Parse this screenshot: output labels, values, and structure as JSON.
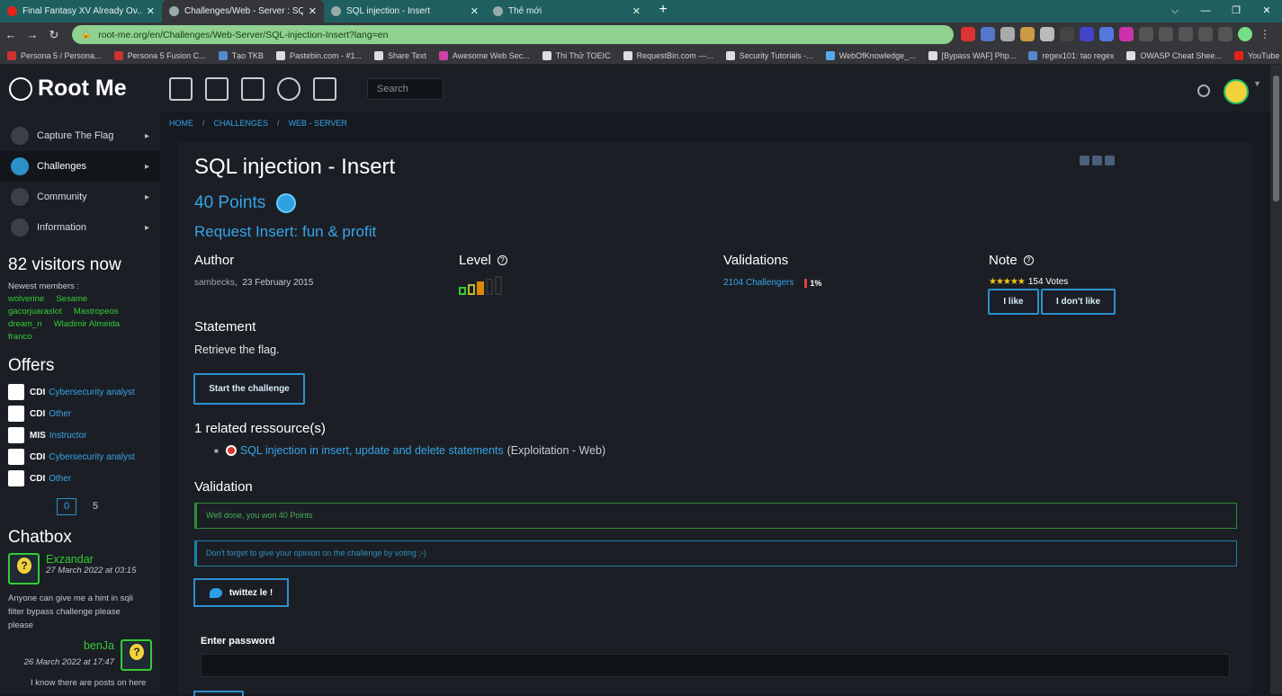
{
  "browser": {
    "tabs": [
      {
        "title": "Final Fantasy XV Already Ov...",
        "color": "#e62117"
      },
      {
        "title": "Challenges/Web - Server : SQL in...",
        "color": "#9aa"
      },
      {
        "title": "SQL injection - Insert",
        "color": "#9aa"
      },
      {
        "title": "Thẻ mới",
        "color": "#9aa"
      }
    ],
    "url": "root-me.org/en/Challenges/Web-Server/SQL-injection-Insert?lang=en",
    "bookmarks": [
      {
        "label": "Persona 5 / Persona...",
        "color": "#c33"
      },
      {
        "label": "Persona 5 Fusion C...",
        "color": "#c33"
      },
      {
        "label": "Tạo TKB",
        "color": "#58c"
      },
      {
        "label": "Pastebin.com - #1...",
        "color": "#ddd"
      },
      {
        "label": "Share Text",
        "color": "#ddd"
      },
      {
        "label": "Awesome Web Sec...",
        "color": "#c4a"
      },
      {
        "label": "Thi Thử TOEIC",
        "color": "#ddd"
      },
      {
        "label": "RequestBin.com —...",
        "color": "#ddd"
      },
      {
        "label": "Security Tutorials -...",
        "color": "#ddd"
      },
      {
        "label": "WebOfKnowledge_...",
        "color": "#5ae"
      },
      {
        "label": "[Bypass WAF] Php...",
        "color": "#ddd"
      },
      {
        "label": "regex101: tạo regex",
        "color": "#58c"
      },
      {
        "label": "OWASP Cheat Shee...",
        "color": "#ddd"
      },
      {
        "label": "YouTube",
        "color": "#e62117"
      }
    ]
  },
  "site": {
    "logo": "Root Me",
    "search_placeholder": "Search"
  },
  "sidebar": {
    "menu": [
      {
        "label": "Capture The Flag"
      },
      {
        "label": "Challenges"
      },
      {
        "label": "Community"
      },
      {
        "label": "Information"
      }
    ],
    "visitors": "82 visitors now",
    "newest_label": "Newest members :",
    "members": [
      "wolverine",
      "Sesame",
      "gacorjuaraslot",
      "Mastropeos",
      "dream_n",
      "Wladimir Almeida",
      "franco"
    ],
    "offers_title": "Offers",
    "offers": [
      {
        "type": "CDI",
        "label": "Cybersecurity analyst"
      },
      {
        "type": "CDI",
        "label": "Other"
      },
      {
        "type": "MIS",
        "label": "Instructor"
      },
      {
        "type": "CDI",
        "label": "Cybersecurity analyst"
      },
      {
        "type": "CDI",
        "label": "Other"
      }
    ],
    "pager": [
      "0",
      "5"
    ],
    "chatbox_title": "Chatbox",
    "chat": [
      {
        "name": "Exzandar",
        "date": "27 March 2022 at 03:15",
        "msg": "Anyone can give me a hint in sqli filter bypass challenge please please"
      },
      {
        "name": "benJa",
        "date": "26 March 2022 at 17:47",
        "msg": "I know there are posts on here"
      }
    ]
  },
  "breadcrumb": [
    "HOME",
    "CHALLENGES",
    "WEB - SERVER"
  ],
  "challenge": {
    "title": "SQL injection - Insert",
    "points": "40 Points",
    "subtitle": "Request Insert: fun & profit",
    "author_h": "Author",
    "author": "sambecks",
    "date": "23 February 2015",
    "level_h": "Level",
    "level": 3,
    "level_max": 5,
    "validations_h": "Validations",
    "challengers": "2104 Challengers",
    "percent": "1%",
    "note_h": "Note",
    "votes": "154 Votes",
    "stars": 5,
    "like": "I like",
    "dislike": "I don't like",
    "statement_h": "Statement",
    "statement": "Retrieve the flag.",
    "start": "Start the challenge",
    "resources_h": "1 related ressource(s)",
    "resource_link": "SQL injection in insert, update and delete statements",
    "resource_cat": "(Exploitation - Web)",
    "validation_h": "Validation",
    "won": "Well done, you won 40 Points",
    "vote_reminder": "Don't forget to give your opinion on the challenge by voting ;-)",
    "tweet": "twittez le !",
    "password_label": "Enter password"
  }
}
